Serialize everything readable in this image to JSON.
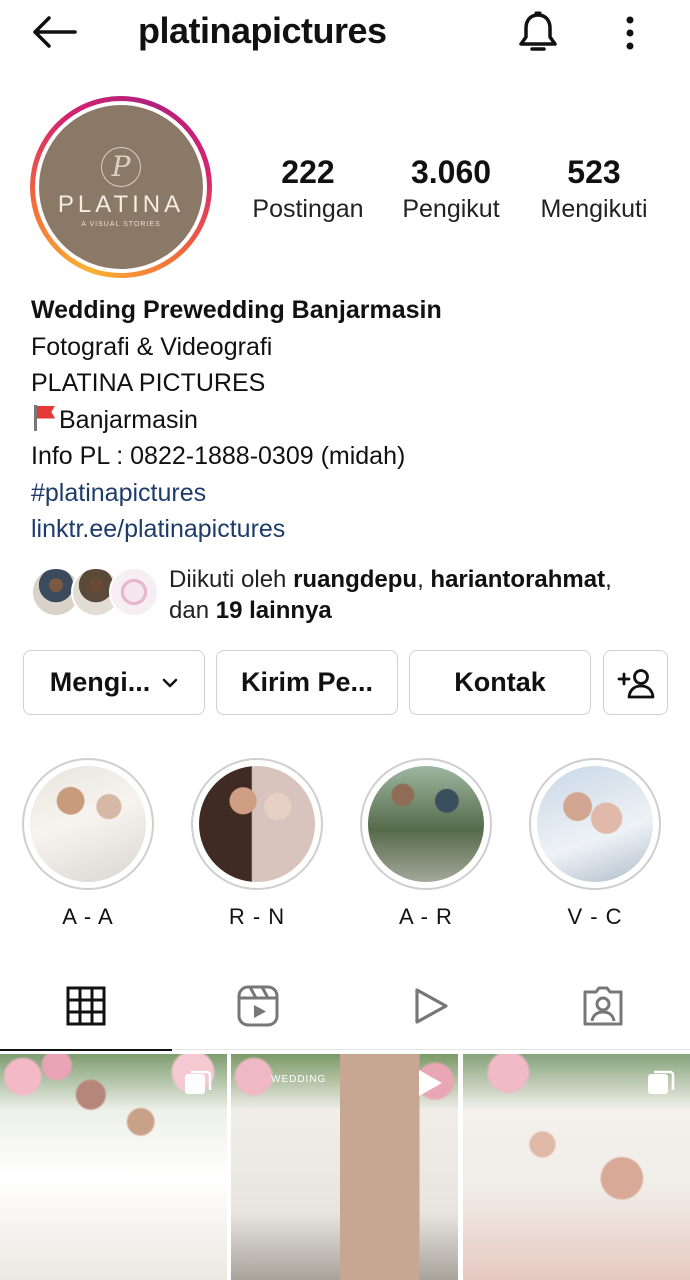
{
  "header": {
    "username": "platinapictures",
    "back_icon": "arrow-left-icon",
    "bell_icon": "bell-icon",
    "more_icon": "more-vertical-icon"
  },
  "avatar": {
    "logo_letter": "P",
    "logo_text": "PLATINA",
    "logo_subtext": "A VISUAL STORIES",
    "ring_color": "#d6246e",
    "bg_color": "#8a7966"
  },
  "stats": {
    "posts": {
      "value": "222",
      "label": "Postingan"
    },
    "followers": {
      "value": "3.060",
      "label": "Pengikut"
    },
    "following": {
      "value": "523",
      "label": "Mengikuti"
    }
  },
  "bio": {
    "name": "Wedding Prewedding Banjarmasin",
    "category": "Fotografi & Videografi",
    "line1": "PLATINA PICTURES",
    "location": "Banjarmasin",
    "info": "Info PL : 0822-1888-0309 (midah)",
    "hashtag": "#platinapictures",
    "link": "linktr.ee/platinapictures",
    "link_color": "#1d3c6c"
  },
  "followed_by": {
    "prefix": "Diikuti oleh ",
    "user1": "ruangdepu",
    "sep": ", ",
    "user2": "hariantorahmat",
    "suffix": ",",
    "and": "dan ",
    "others": "19 lainnya"
  },
  "actions": {
    "following": "Mengi...",
    "message": "Kirim Pe...",
    "contact": "Kontak",
    "add_user_icon": "add-user-icon"
  },
  "highlights": [
    {
      "label": "A - A"
    },
    {
      "label": "R - N"
    },
    {
      "label": "A - R"
    },
    {
      "label": "V - C"
    }
  ],
  "tabs": [
    {
      "icon": "grid-icon",
      "active": true
    },
    {
      "icon": "reels-icon",
      "active": false
    },
    {
      "icon": "play-icon",
      "active": false
    },
    {
      "icon": "tagged-icon",
      "active": false
    }
  ],
  "grid": {
    "post2_caption": "WEDDING"
  }
}
